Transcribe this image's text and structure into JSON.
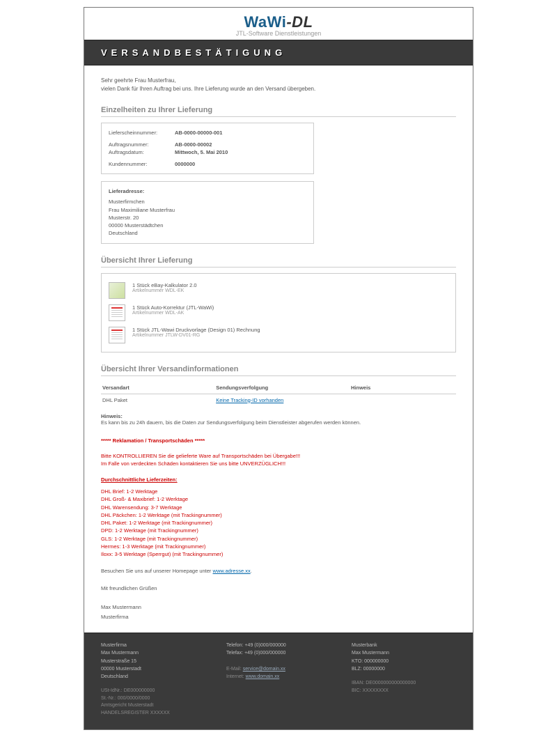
{
  "logo": {
    "brand_a": "WaWi",
    "brand_b": "-DL",
    "subtitle": "JTL-Software Dienstleistungen"
  },
  "title": "VERSANDBESTÄTIGUNG",
  "greeting": "Sehr geehrte Frau Musterfrau,",
  "thanks": "vielen Dank für Ihren Auftrag bei uns. Ihre Lieferung wurde an den Versand übergeben.",
  "details_heading": "Einzelheiten zu Ihrer Lieferung",
  "details": {
    "lieferschein_k": "Lieferscheinnummer:",
    "lieferschein_v": "AB-0000-00000-001",
    "auftragnr_k": "Auftragsnummer:",
    "auftragnr_v": "AB-0000-00002",
    "auftragdat_k": "Auftragsdatum:",
    "auftragdat_v": "Mittwoch, 5. Mai 2010",
    "kundennr_k": "Kundennummer:",
    "kundennr_v": "0000000"
  },
  "address": {
    "heading": "Lieferadresse:",
    "lines": {
      "l0": "Musterfirmchen",
      "l1": "Frau Maximiliane Musterfrau",
      "l2": "Musterstr. 20",
      "l3": "00000 Musterstädtchen",
      "l4": "Deutschland"
    }
  },
  "items_heading": "Übersicht Ihrer Lieferung",
  "items": {
    "i0": {
      "title": "1 Stück eBay-Kalkulator 2.0",
      "sku": "Artikelnummer WDL-EK"
    },
    "i1": {
      "title": "1 Stück Auto-Korrektur (JTL-WaWi)",
      "sku": "Artikelnummer WDL-AK"
    },
    "i2": {
      "title": "1 Stück JTL-Wawi Druckvorlage (Design 01) Rechnung",
      "sku": "Artikelnummer JTLW-DV01-RG"
    }
  },
  "ship_heading": "Übersicht Ihrer Versandinformationen",
  "ship_table": {
    "col_versandart": "Versandart",
    "col_tracking": "Sendungsverfolgung",
    "col_hinweis": "Hinweis",
    "row_versandart": "DHL Paket",
    "row_tracking": "Keine Tracking-ID vorhanden",
    "row_hinweis": ""
  },
  "note": {
    "label": "Hinweis:",
    "text": "Es kann bis zu 24h dauern, bis die Daten zur Sendungsverfolgung beim Dienstleister abgerufen werden können."
  },
  "red": {
    "heading": "***** Reklamation / Transportschäden *****",
    "l1": "Bitte KONTROLLIEREN Sie die gelieferte Ware auf Transportschäden bei Übergabe!!!",
    "l2": "Im Falle von verdeckten Schäden kontaktieren Sie uns bitte UNVERZÜGLICH!!!",
    "times_heading": "Durchschnittliche Lieferzeiten:",
    "times": {
      "t0": "DHL Brief: 1-2 Werktage",
      "t1": "DHL Groß- & Maxibrief: 1-2 Werktage",
      "t2": "DHL Warensendung: 3-7 Werktage",
      "t3": "DHL Päckchen: 1-2 Werktage (mit Trackingnummer)",
      "t4": "DHL Paket: 1-2 Werktage (mit Trackingnummer)",
      "t5": "DPD: 1-2 Werktage (mit Trackingnummer)",
      "t6": "GLS: 1-2 Werktage (mit Trackingnummer)",
      "t7": "Hermes: 1-3 Werktage (mit Trackingnummer)",
      "t8": "Iloxx: 3-5 Werktage (Sperrgut) (mit Trackingnummer)"
    }
  },
  "visit": {
    "text": "Besuchen Sie uns auf unserer Homepage unter ",
    "link": "www.adresse.xx"
  },
  "signoff": {
    "l0": "Mit freundlichen Grüßen",
    "l1": "Max Mustermann",
    "l2": "Musterfirma"
  },
  "footer": {
    "col1": {
      "l0": "Musterfirma",
      "l1": "Max Mustermann",
      "l2": "Musterstraße 15",
      "l3": "00000 Musterstadt",
      "l4": "Deutschland"
    },
    "col2": {
      "l0": "Telefon: +49 (0)000/000000",
      "l1": "Telefax: +49 (0)000/000000",
      "l2_k": "E-Mail: ",
      "l2_v": "service@domain.xx",
      "l3_k": "Internet: ",
      "l3_v": "www.domain.xx"
    },
    "col3": {
      "l0": "Musterbank",
      "l1": "Max Mustermann",
      "l2": "KTO: 000000000",
      "l3": "BLZ: 00000000"
    },
    "extra": {
      "l0": "USt-IdNr.: DE000000000",
      "l1": "St.-Nr.: 000/0000/0000",
      "l2": "Amtsgericht Musterstadt",
      "l3": "HANDELSREGISTER XXXXXX"
    },
    "extra_r": {
      "l0": "IBAN: DE0000000000000000",
      "l1": "BIC: XXXXXXXX"
    }
  }
}
